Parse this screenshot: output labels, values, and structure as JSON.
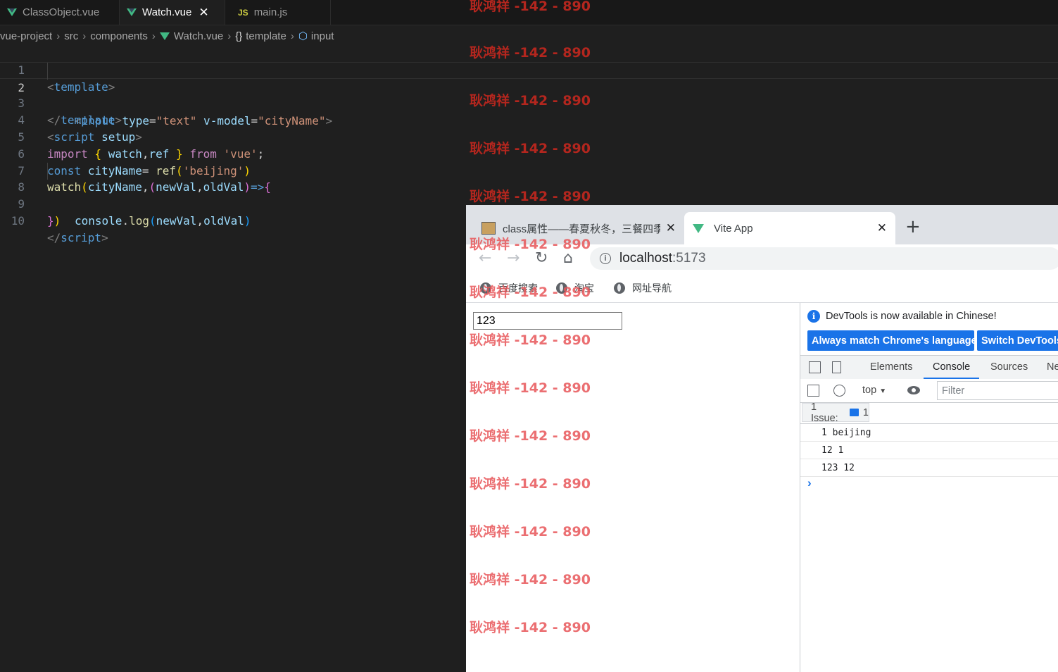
{
  "editor": {
    "tabs": [
      {
        "label": "ClassObject.vue",
        "icon": "vue-icon"
      },
      {
        "label": "Watch.vue",
        "icon": "vue-icon",
        "active": true
      },
      {
        "label": "main.js",
        "icon": "js-icon",
        "icon_text": "JS"
      }
    ],
    "close_glyph": "✕",
    "breadcrumb": [
      "vue-project",
      "src",
      "components",
      "Watch.vue",
      "template",
      "input"
    ],
    "breadcrumb_brace": "{}",
    "line_numbers": [
      "1",
      "2",
      "3",
      "4",
      "5",
      "6",
      "7",
      "8",
      "9",
      "10"
    ],
    "code": {
      "l1": {
        "open": "<",
        "tag": "template",
        "close": ">"
      },
      "l2": {
        "open": "<",
        "tag": "input",
        "attr1": " type",
        "eq1": "=",
        "val1": "\"text\"",
        "attr2": " v-model",
        "eq2": "=",
        "val2": "\"cityName\"",
        "close": ">"
      },
      "l3": {
        "open": "</",
        "tag": "template",
        "close": ">"
      },
      "l4": {
        "open": "<",
        "tag": "script",
        "attr": " setup",
        "close": ">"
      },
      "l5": {
        "kw": "import",
        "b1": " { ",
        "a": "watch",
        "comma": ",",
        "b": "ref",
        "b2": " } ",
        "from": "from",
        "str": " 'vue'",
        "semi": ";"
      },
      "l6": {
        "decl": "const",
        "var": " cityName",
        "eq": "= ",
        "fn": "ref",
        "p1": "(",
        "str": "'beijing'",
        "p2": ")"
      },
      "l7": {
        "fn": "watch",
        "p1": "(",
        "var": "cityName",
        "comma": ",",
        "p2": "(",
        "a": "newVal",
        "comma2": ",",
        "b": "oldVal",
        "p3": ")",
        "arrow": "=>",
        "brace": "{"
      },
      "l8": {
        "obj": "console",
        "dot": ".",
        "fn": "log",
        "p1": "(",
        "a": "newVal",
        "comma": ",",
        "b": "oldVal",
        "p2": ")"
      },
      "l9": {
        "brace": "}",
        "p": ")"
      },
      "l10": {
        "open": "</",
        "tag": "script",
        "close": ">"
      }
    }
  },
  "browser": {
    "tabs": [
      {
        "title": "class属性——春夏秋冬，三餐四季",
        "icon": "blog-favicon"
      },
      {
        "title": "Vite App",
        "icon": "vue-icon",
        "active": true
      }
    ],
    "tab_close": "✕",
    "new_tab": "+",
    "nav": {
      "back": "←",
      "forward": "→",
      "reload": "↻",
      "home": "⌂"
    },
    "url": {
      "host": "localhost",
      "port": ":5173",
      "info_glyph": "i"
    },
    "bookmarks": [
      "百度搜索",
      "淘宝",
      "网址导航"
    ],
    "page": {
      "input_value": "123"
    }
  },
  "devtools": {
    "notice": "DevTools is now available in Chinese!",
    "info_glyph": "i",
    "btn_match": "Always match Chrome's language",
    "btn_switch": "Switch DevTools to Chinese",
    "tabs": [
      "Elements",
      "Console",
      "Sources",
      "Network"
    ],
    "context": "top",
    "context_arrow": "▼",
    "filter_placeholder": "Filter",
    "issues_label": "1 Issue:",
    "issues_count": "1",
    "logs": [
      "1 beijing",
      "12 1",
      "123 12"
    ],
    "prompt": "›"
  },
  "watermark": "耿鸿祥 -142 - 890"
}
